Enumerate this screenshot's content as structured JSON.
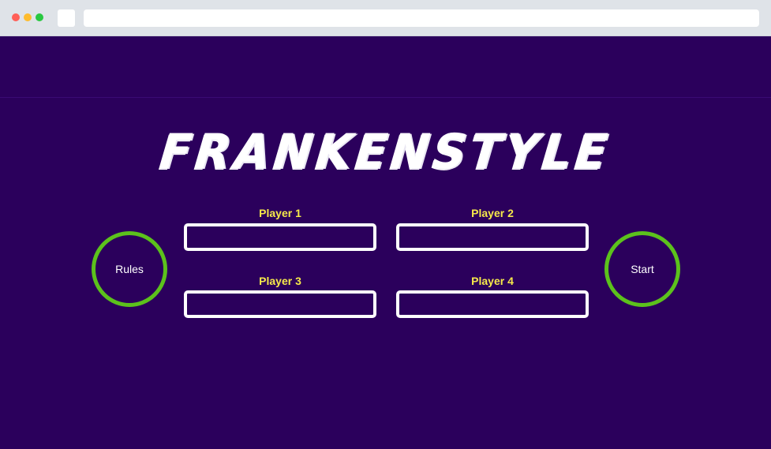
{
  "title": "FRANKENSTYLE",
  "players": [
    {
      "label": "Player 1",
      "value": "",
      "placeholder": ""
    },
    {
      "label": "Player 2",
      "value": "",
      "placeholder": ""
    },
    {
      "label": "Player 3",
      "value": "",
      "placeholder": ""
    },
    {
      "label": "Player 4",
      "value": "",
      "placeholder": ""
    }
  ],
  "buttons": {
    "rules": "Rules",
    "start": "Start"
  },
  "colors": {
    "background": "#2b005c",
    "label": "#f6e94a",
    "button_ring": "#5cc21c",
    "input_border": "#ffffff"
  }
}
